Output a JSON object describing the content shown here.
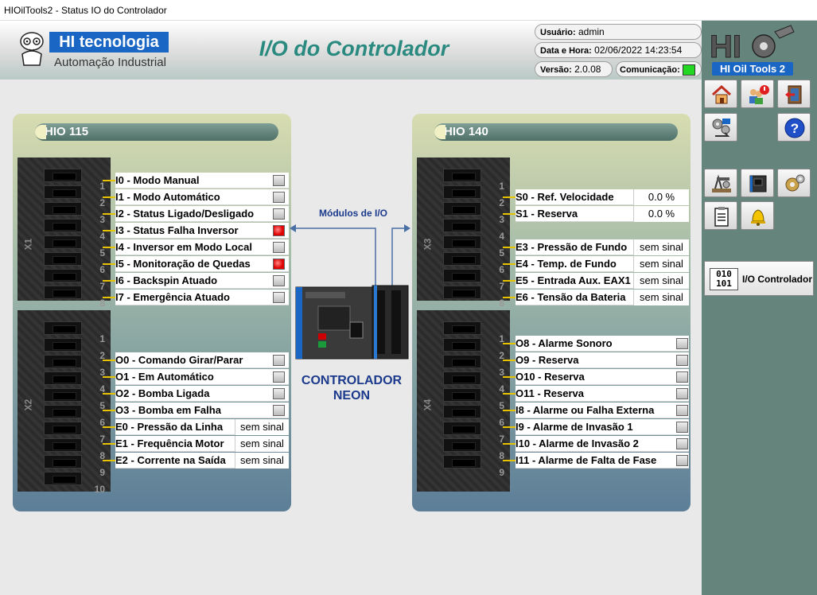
{
  "window": {
    "title": "HIOilTools2 - Status IO do Controlador"
  },
  "header": {
    "brand": "HI tecnologia",
    "brand_sub": "Automação Industrial",
    "page_title": "I/O do Controlador",
    "user_label": "Usuário:",
    "user_value": "admin",
    "datetime_label": "Data e Hora:",
    "datetime_value": "02/06/2022 14:23:54",
    "version_label": "Versão:",
    "version_value": "2.0.08",
    "comm_label": "Comunicação:",
    "product_logo_text": "HI Oil Tools 2"
  },
  "center": {
    "modules_label": "Módulos de I/O",
    "controller_line1": "CONTROLADOR",
    "controller_line2": "NEON"
  },
  "module_left": {
    "title": "HIO 115",
    "connectors": [
      "X1",
      "X2"
    ],
    "pin_numbers_x1": [
      "1",
      "2",
      "3",
      "4",
      "5",
      "6",
      "7",
      "8"
    ],
    "pin_numbers_x2": [
      "1",
      "2",
      "3",
      "4",
      "5",
      "6",
      "7",
      "8",
      "9",
      "10"
    ],
    "rows": [
      {
        "label": "I0 - Modo Manual",
        "state": "off"
      },
      {
        "label": "I1 - Modo Automático",
        "state": "off"
      },
      {
        "label": "I2 - Status Ligado/Desligado",
        "state": "off"
      },
      {
        "label": "I3 - Status Falha Inversor",
        "state": "on"
      },
      {
        "label": "I4 - Inversor em Modo Local",
        "state": "off"
      },
      {
        "label": "I5 - Monitoração de Quedas",
        "state": "on"
      },
      {
        "label": "I6 - Backspin Atuado",
        "state": "off"
      },
      {
        "label": "I7 - Emergência Atuado",
        "state": "off"
      },
      {
        "label": "O0 - Comando Girar/Parar",
        "state": "off"
      },
      {
        "label": "O1 - Em Automático",
        "state": "off"
      },
      {
        "label": "O2 - Bomba Ligada",
        "state": "off"
      },
      {
        "label": "O3 - Bomba em Falha",
        "state": "off"
      },
      {
        "label": "E0 - Pressão da Linha",
        "value": "sem sinal"
      },
      {
        "label": "E1 - Frequência Motor",
        "value": "sem sinal"
      },
      {
        "label": "E2 - Corrente na Saída",
        "value": "sem sinal"
      }
    ]
  },
  "module_right": {
    "title": "HIO 140",
    "connectors": [
      "X3",
      "X4"
    ],
    "pin_numbers_x3": [
      "1",
      "2",
      "3",
      "4",
      "5",
      "6",
      "7",
      "8"
    ],
    "pin_numbers_x4": [
      "1",
      "2",
      "3",
      "4",
      "5",
      "6",
      "7",
      "8",
      "9"
    ],
    "rows": [
      {
        "label": "S0 - Ref. Velocidade",
        "value": "0.0 %"
      },
      {
        "label": "S1 - Reserva",
        "value": "0.0 %"
      },
      {
        "label": "E3 - Pressão de Fundo",
        "value": "sem sinal"
      },
      {
        "label": "E4 - Temp. de Fundo",
        "value": "sem sinal"
      },
      {
        "label": "E5 - Entrada Aux. EAX1",
        "value": "sem sinal"
      },
      {
        "label": "E6 - Tensão da Bateria",
        "value": "sem sinal"
      },
      {
        "label": "O8 - Alarme Sonoro",
        "state": "off"
      },
      {
        "label": "O9 - Reserva",
        "state": "off"
      },
      {
        "label": "O10 - Reserva",
        "state": "off"
      },
      {
        "label": "O11 - Reserva",
        "state": "off"
      },
      {
        "label": "I8 - Alarme ou Falha Externa",
        "state": "off"
      },
      {
        "label": "I9 - Alarme de Invasão 1",
        "state": "off"
      },
      {
        "label": "I10 - Alarme de Invasão 2",
        "state": "off"
      },
      {
        "label": "I11 - Alarme de Falta de Fase",
        "state": "off"
      }
    ]
  },
  "sidebar": {
    "io_button_label": "I/O Controlador",
    "io_button_digits": [
      "010",
      "101"
    ],
    "buttons": [
      "home-icon",
      "users-power-icon",
      "exit-door-icon",
      "config-gears-icon",
      "help-icon",
      "oil-pump-icon",
      "controller-icon",
      "settings-gears-icon",
      "report-clipboard-icon",
      "alarm-bell-icon"
    ]
  },
  "colors": {
    "accent_title": "#2a8a80",
    "brand_blue": "#1a66c4",
    "led_red": "#e00000",
    "comm_ok": "#22d822",
    "sidebar_bg": "#64847c"
  }
}
